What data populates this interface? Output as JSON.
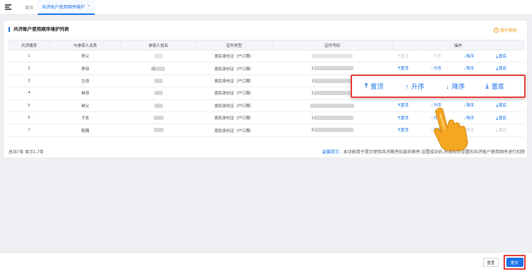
{
  "tabs": {
    "home": "首页",
    "active": "共济账户使用顺序维护",
    "close": "×"
  },
  "panel": {
    "title": "共济账户使用顺序维护列表",
    "help": "操作帮助",
    "help_icon": "?"
  },
  "table": {
    "headers": [
      "共济顺序",
      "与参保人关系",
      "参保人姓名",
      "证件类型",
      "证件号码",
      "操作"
    ],
    "rows": [
      {
        "order": "1",
        "relation": "养父",
        "id_type": "居民身份证（户口簿）"
      },
      {
        "order": "2",
        "relation": "养母",
        "name_prefix": "田",
        "id_type": "居民身份证（户口簿）",
        "id_prefix": "1"
      },
      {
        "order": "3",
        "relation": "生母",
        "id_type": "居民身份证（户口簿）",
        "id_prefix": "1"
      },
      {
        "order": "4",
        "relation": "继母",
        "id_type": "居民身份证（户口簿）",
        "id_prefix": "1"
      },
      {
        "order": "5",
        "relation": "继父",
        "id_type": "居民身份证（户口簿）"
      },
      {
        "order": "6",
        "relation": "子女",
        "id_type": "居民身份证（户口簿）",
        "id_prefix": "1"
      },
      {
        "order": "7",
        "relation": "配偶",
        "id_type": "居民身份证（户口簿）",
        "id_prefix": "4"
      }
    ],
    "ops": {
      "top": "置顶",
      "up": "升序",
      "down": "降序",
      "bottom": "置底"
    }
  },
  "footer_info": {
    "total": "总共7条 显示1-7条",
    "tip_label": "温馨提示：",
    "tip_text": "本功能用于提示使用共济顺序扣款的顺序,设置成功后,将按照你设置的共济账户使用顺序进行扣除"
  },
  "popup": {
    "top": "置顶",
    "up": "升序",
    "down": "降序",
    "bottom": "置底"
  },
  "footer": {
    "reset": "重置",
    "submit": "提交"
  },
  "colors": {
    "accent": "#1a73e8",
    "highlight": "#e53935",
    "cursor": "#f5a623"
  },
  "icons": {
    "menu": "menu-icon",
    "cursor": "hand-pointer-icon"
  }
}
